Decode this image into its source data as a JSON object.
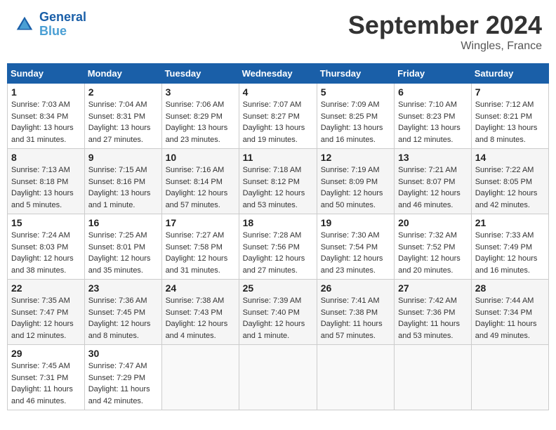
{
  "header": {
    "logo_line1": "General",
    "logo_line2": "Blue",
    "month": "September 2024",
    "location": "Wingles, France"
  },
  "days_of_week": [
    "Sunday",
    "Monday",
    "Tuesday",
    "Wednesday",
    "Thursday",
    "Friday",
    "Saturday"
  ],
  "weeks": [
    [
      {
        "day": "1",
        "sunrise": "7:03 AM",
        "sunset": "8:34 PM",
        "daylight": "13 hours and 31 minutes."
      },
      {
        "day": "2",
        "sunrise": "7:04 AM",
        "sunset": "8:31 PM",
        "daylight": "13 hours and 27 minutes."
      },
      {
        "day": "3",
        "sunrise": "7:06 AM",
        "sunset": "8:29 PM",
        "daylight": "13 hours and 23 minutes."
      },
      {
        "day": "4",
        "sunrise": "7:07 AM",
        "sunset": "8:27 PM",
        "daylight": "13 hours and 19 minutes."
      },
      {
        "day": "5",
        "sunrise": "7:09 AM",
        "sunset": "8:25 PM",
        "daylight": "13 hours and 16 minutes."
      },
      {
        "day": "6",
        "sunrise": "7:10 AM",
        "sunset": "8:23 PM",
        "daylight": "13 hours and 12 minutes."
      },
      {
        "day": "7",
        "sunrise": "7:12 AM",
        "sunset": "8:21 PM",
        "daylight": "13 hours and 8 minutes."
      }
    ],
    [
      {
        "day": "8",
        "sunrise": "7:13 AM",
        "sunset": "8:18 PM",
        "daylight": "13 hours and 5 minutes."
      },
      {
        "day": "9",
        "sunrise": "7:15 AM",
        "sunset": "8:16 PM",
        "daylight": "13 hours and 1 minute."
      },
      {
        "day": "10",
        "sunrise": "7:16 AM",
        "sunset": "8:14 PM",
        "daylight": "12 hours and 57 minutes."
      },
      {
        "day": "11",
        "sunrise": "7:18 AM",
        "sunset": "8:12 PM",
        "daylight": "12 hours and 53 minutes."
      },
      {
        "day": "12",
        "sunrise": "7:19 AM",
        "sunset": "8:09 PM",
        "daylight": "12 hours and 50 minutes."
      },
      {
        "day": "13",
        "sunrise": "7:21 AM",
        "sunset": "8:07 PM",
        "daylight": "12 hours and 46 minutes."
      },
      {
        "day": "14",
        "sunrise": "7:22 AM",
        "sunset": "8:05 PM",
        "daylight": "12 hours and 42 minutes."
      }
    ],
    [
      {
        "day": "15",
        "sunrise": "7:24 AM",
        "sunset": "8:03 PM",
        "daylight": "12 hours and 38 minutes."
      },
      {
        "day": "16",
        "sunrise": "7:25 AM",
        "sunset": "8:01 PM",
        "daylight": "12 hours and 35 minutes."
      },
      {
        "day": "17",
        "sunrise": "7:27 AM",
        "sunset": "7:58 PM",
        "daylight": "12 hours and 31 minutes."
      },
      {
        "day": "18",
        "sunrise": "7:28 AM",
        "sunset": "7:56 PM",
        "daylight": "12 hours and 27 minutes."
      },
      {
        "day": "19",
        "sunrise": "7:30 AM",
        "sunset": "7:54 PM",
        "daylight": "12 hours and 23 minutes."
      },
      {
        "day": "20",
        "sunrise": "7:32 AM",
        "sunset": "7:52 PM",
        "daylight": "12 hours and 20 minutes."
      },
      {
        "day": "21",
        "sunrise": "7:33 AM",
        "sunset": "7:49 PM",
        "daylight": "12 hours and 16 minutes."
      }
    ],
    [
      {
        "day": "22",
        "sunrise": "7:35 AM",
        "sunset": "7:47 PM",
        "daylight": "12 hours and 12 minutes."
      },
      {
        "day": "23",
        "sunrise": "7:36 AM",
        "sunset": "7:45 PM",
        "daylight": "12 hours and 8 minutes."
      },
      {
        "day": "24",
        "sunrise": "7:38 AM",
        "sunset": "7:43 PM",
        "daylight": "12 hours and 4 minutes."
      },
      {
        "day": "25",
        "sunrise": "7:39 AM",
        "sunset": "7:40 PM",
        "daylight": "12 hours and 1 minute."
      },
      {
        "day": "26",
        "sunrise": "7:41 AM",
        "sunset": "7:38 PM",
        "daylight": "11 hours and 57 minutes."
      },
      {
        "day": "27",
        "sunrise": "7:42 AM",
        "sunset": "7:36 PM",
        "daylight": "11 hours and 53 minutes."
      },
      {
        "day": "28",
        "sunrise": "7:44 AM",
        "sunset": "7:34 PM",
        "daylight": "11 hours and 49 minutes."
      }
    ],
    [
      {
        "day": "29",
        "sunrise": "7:45 AM",
        "sunset": "7:31 PM",
        "daylight": "11 hours and 46 minutes."
      },
      {
        "day": "30",
        "sunrise": "7:47 AM",
        "sunset": "7:29 PM",
        "daylight": "11 hours and 42 minutes."
      },
      null,
      null,
      null,
      null,
      null
    ]
  ]
}
